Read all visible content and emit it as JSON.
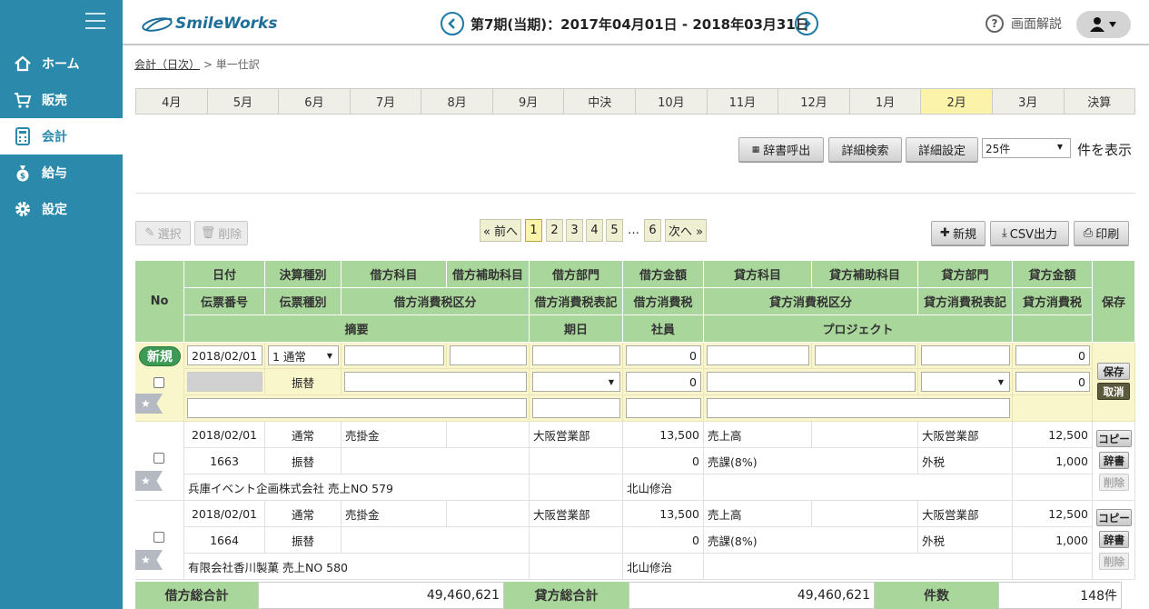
{
  "sidebar": {
    "items": [
      {
        "label": "ホーム"
      },
      {
        "label": "販売"
      },
      {
        "label": "会計"
      },
      {
        "label": "給与"
      },
      {
        "label": "設定"
      }
    ]
  },
  "header": {
    "logo": "SmileWorks",
    "period": "第7期(当期)：2017年04月01日 - 2018年03月31日",
    "help": "画面解説"
  },
  "breadcrumb": {
    "parent": "会計（日次）",
    "sep": " > ",
    "current": "単一仕訳"
  },
  "months": [
    "4月",
    "5月",
    "6月",
    "7月",
    "8月",
    "9月",
    "中決",
    "10月",
    "11月",
    "12月",
    "1月",
    "2月",
    "3月",
    "決算"
  ],
  "toolbar": {
    "dict": "辞書呼出",
    "search": "詳細検索",
    "settings": "詳細設定",
    "perpage": "25件",
    "perpage_suffix": "件を表示",
    "select": "選択",
    "delete": "削除",
    "new": "新規",
    "csv": "CSV出力",
    "print": "印刷"
  },
  "pager": {
    "prev": "« 前へ",
    "pages": [
      "1",
      "2",
      "3",
      "4",
      "5"
    ],
    "ellipsis": "…",
    "last": "6",
    "next": "次へ »"
  },
  "columns": {
    "no": "No",
    "date": "日付",
    "kessan": "決算種別",
    "debit_acct": "借方科目",
    "debit_sub": "借方補助科目",
    "debit_dept": "借方部門",
    "debit_amt": "借方金額",
    "credit_acct": "貸方科目",
    "credit_sub": "貸方補助科目",
    "credit_dept": "貸方部門",
    "credit_amt": "貸方金額",
    "slip_no": "伝票番号",
    "slip_type": "伝票種別",
    "debit_tax": "借方消費税区分",
    "debit_taxnote": "借方消費税表記",
    "debit_taxamt": "借方消費税",
    "credit_tax": "貸方消費税区分",
    "credit_taxnote": "貸方消費税表記",
    "credit_taxamt": "貸方消費税",
    "memo": "摘要",
    "due": "期日",
    "staff": "社員",
    "project": "プロジェクト",
    "save": "保存"
  },
  "newrow": {
    "badge": "新規",
    "date": "2018/02/01",
    "kessan": "1 通常",
    "debit_amt": "0",
    "slip_type": "振替",
    "debit_taxamt": "0",
    "credit_amt": "0",
    "credit_taxamt": "0",
    "save": "保存",
    "cancel": "取消"
  },
  "rows": [
    {
      "date": "2018/02/01",
      "kessan": "通常",
      "debit_acct": "売掛金",
      "debit_dept": "大阪営業部",
      "debit_amt": "13,500",
      "credit_acct": "売上高",
      "credit_dept": "大阪営業部",
      "credit_amt": "12,500",
      "slip_no": "1663",
      "slip_type": "振替",
      "debit_taxamt": "0",
      "credit_tax": "売課(8%)",
      "credit_taxnote": "外税",
      "credit_taxamt": "1,000",
      "memo": "兵庫イベント企画株式会社 売上NO 579",
      "staff": "北山修治"
    },
    {
      "date": "2018/02/01",
      "kessan": "通常",
      "debit_acct": "売掛金",
      "debit_dept": "大阪営業部",
      "debit_amt": "13,500",
      "credit_acct": "売上高",
      "credit_dept": "大阪営業部",
      "credit_amt": "12,500",
      "slip_no": "1664",
      "slip_type": "振替",
      "debit_taxamt": "0",
      "credit_tax": "売課(8%)",
      "credit_taxnote": "外税",
      "credit_taxamt": "1,000",
      "memo": "有限会社香川製菓 売上NO 580",
      "staff": "北山修治"
    }
  ],
  "rowbtns": {
    "copy": "コピー",
    "dict": "辞書",
    "delete": "削除"
  },
  "totals": {
    "debit_label": "借方総合計",
    "debit": "49,460,621",
    "credit_label": "貸方総合計",
    "credit": "49,460,621",
    "count_label": "件数",
    "count": "148件"
  },
  "colors": {
    "sidebar": "#2b8aac",
    "header_green": "#a9d69a",
    "new_row": "#faf6cc",
    "selected_month": "#fbf3a9"
  }
}
